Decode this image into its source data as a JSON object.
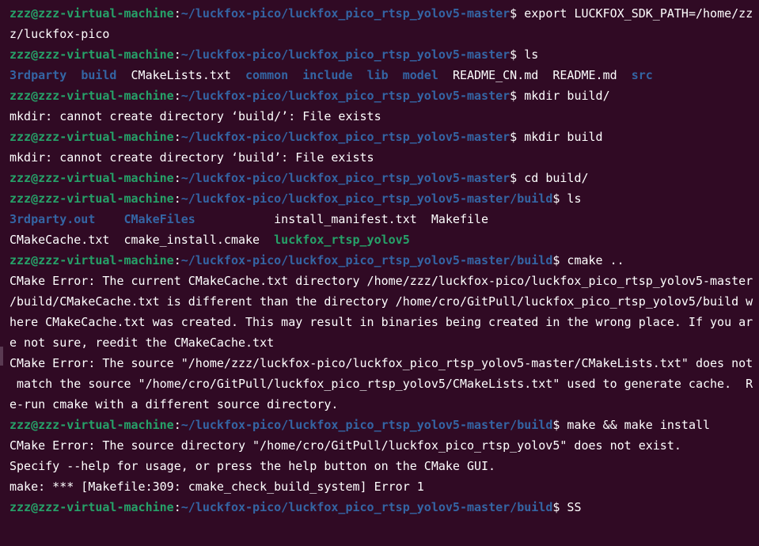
{
  "colors": {
    "background": "#300a24",
    "user_host": "#26a269",
    "path": "#3465a4",
    "directory": "#3465a4",
    "executable": "#26a269",
    "text": "#ffffff"
  },
  "lines": [
    {
      "type": "prompt",
      "user_host": "zzz@zzz-virtual-machine",
      "sep": ":",
      "path": "~/luckfox-pico/luckfox_pico_rtsp_yolov5-master",
      "symbol": "$ ",
      "command": "export LUCKFOX_SDK_PATH=/home/zz"
    },
    {
      "type": "output",
      "text": "z/luckfox-pico"
    },
    {
      "type": "prompt",
      "user_host": "zzz@zzz-virtual-machine",
      "sep": ":",
      "path": "~/luckfox-pico/luckfox_pico_rtsp_yolov5-master",
      "symbol": "$ ",
      "command": "ls"
    },
    {
      "type": "ls",
      "items": [
        {
          "name": "3rdparty",
          "kind": "dir",
          "gap": "  "
        },
        {
          "name": "build",
          "kind": "dir",
          "gap": "  "
        },
        {
          "name": "CMakeLists.txt",
          "kind": "file",
          "gap": "  "
        },
        {
          "name": "common",
          "kind": "dir",
          "gap": "  "
        },
        {
          "name": "include",
          "kind": "dir",
          "gap": "  "
        },
        {
          "name": "lib",
          "kind": "dir",
          "gap": "  "
        },
        {
          "name": "model",
          "kind": "dir",
          "gap": "  "
        },
        {
          "name": "README_CN.md",
          "kind": "file",
          "gap": "  "
        },
        {
          "name": "README.md",
          "kind": "file",
          "gap": "  "
        },
        {
          "name": "src",
          "kind": "dir",
          "gap": ""
        }
      ]
    },
    {
      "type": "prompt",
      "user_host": "zzz@zzz-virtual-machine",
      "sep": ":",
      "path": "~/luckfox-pico/luckfox_pico_rtsp_yolov5-master",
      "symbol": "$ ",
      "command": "mkdir build/"
    },
    {
      "type": "output",
      "text": "mkdir: cannot create directory ‘build/’: File exists"
    },
    {
      "type": "prompt",
      "user_host": "zzz@zzz-virtual-machine",
      "sep": ":",
      "path": "~/luckfox-pico/luckfox_pico_rtsp_yolov5-master",
      "symbol": "$ ",
      "command": "mkdir build"
    },
    {
      "type": "output",
      "text": "mkdir: cannot create directory ‘build’: File exists"
    },
    {
      "type": "prompt",
      "user_host": "zzz@zzz-virtual-machine",
      "sep": ":",
      "path": "~/luckfox-pico/luckfox_pico_rtsp_yolov5-master",
      "symbol": "$ ",
      "command": "cd build/"
    },
    {
      "type": "prompt",
      "user_host": "zzz@zzz-virtual-machine",
      "sep": ":",
      "path": "~/luckfox-pico/luckfox_pico_rtsp_yolov5-master/build",
      "symbol": "$ ",
      "command": "ls"
    },
    {
      "type": "ls",
      "items": [
        {
          "name": "3rdparty.out",
          "kind": "dir",
          "gap": "    "
        },
        {
          "name": "CMakeFiles",
          "kind": "dir",
          "gap": "           "
        },
        {
          "name": "install_manifest.txt",
          "kind": "file",
          "gap": "  "
        },
        {
          "name": "Makefile",
          "kind": "file",
          "gap": ""
        }
      ]
    },
    {
      "type": "ls",
      "items": [
        {
          "name": "CMakeCache.txt",
          "kind": "file",
          "gap": "  "
        },
        {
          "name": "cmake_install.cmake",
          "kind": "file",
          "gap": "  "
        },
        {
          "name": "luckfox_rtsp_yolov5",
          "kind": "exec",
          "gap": ""
        }
      ]
    },
    {
      "type": "prompt",
      "user_host": "zzz@zzz-virtual-machine",
      "sep": ":",
      "path": "~/luckfox-pico/luckfox_pico_rtsp_yolov5-master/build",
      "symbol": "$ ",
      "command": "cmake .."
    },
    {
      "type": "output",
      "text": "CMake Error: The current CMakeCache.txt directory /home/zzz/luckfox-pico/luckfox_pico_rtsp_yolov5-master"
    },
    {
      "type": "output",
      "text": "/build/CMakeCache.txt is different than the directory /home/cro/GitPull/luckfox_pico_rtsp_yolov5/build w"
    },
    {
      "type": "output",
      "text": "here CMakeCache.txt was created. This may result in binaries being created in the wrong place. If you ar"
    },
    {
      "type": "output",
      "text": "e not sure, reedit the CMakeCache.txt"
    },
    {
      "type": "output",
      "text": "CMake Error: The source \"/home/zzz/luckfox-pico/luckfox_pico_rtsp_yolov5-master/CMakeLists.txt\" does not"
    },
    {
      "type": "output",
      "text": " match the source \"/home/cro/GitPull/luckfox_pico_rtsp_yolov5/CMakeLists.txt\" used to generate cache.  R"
    },
    {
      "type": "output",
      "text": "e-run cmake with a different source directory."
    },
    {
      "type": "prompt",
      "user_host": "zzz@zzz-virtual-machine",
      "sep": ":",
      "path": "~/luckfox-pico/luckfox_pico_rtsp_yolov5-master/build",
      "symbol": "$ ",
      "command": "make && make install"
    },
    {
      "type": "output",
      "text": "CMake Error: The source directory \"/home/cro/GitPull/luckfox_pico_rtsp_yolov5\" does not exist."
    },
    {
      "type": "output",
      "text": "Specify --help for usage, or press the help button on the CMake GUI."
    },
    {
      "type": "output",
      "text": "make: *** [Makefile:309: cmake_check_build_system] Error 1"
    },
    {
      "type": "prompt",
      "user_host": "zzz@zzz-virtual-machine",
      "sep": ":",
      "path": "~/luckfox-pico/luckfox_pico_rtsp_yolov5-master/build",
      "symbol": "$ ",
      "command": "SS"
    }
  ]
}
